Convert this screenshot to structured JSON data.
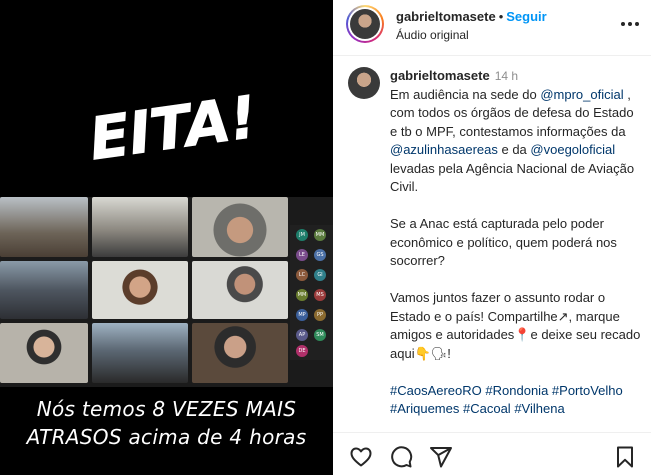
{
  "media": {
    "headline": "EITA!",
    "caption_lines": [
      "Nós temos 8 VEZES MAIS",
      "ATRASOS acima de 4 horas"
    ],
    "video_participants_initials": [
      "JM",
      "MM",
      "LE",
      "GS",
      "LC",
      "GI",
      "MM",
      "MS",
      "MP",
      "PP",
      "AP",
      "SM",
      "DE"
    ]
  },
  "header": {
    "username": "gabrieltomasete",
    "separator": "•",
    "follow_label": "Seguir",
    "audio_label": "Áudio original",
    "more_icon": "more-horizontal-icon"
  },
  "comment": {
    "username": "gabrieltomasete",
    "time": "14 h",
    "p1_a": "Em audiência na sede do ",
    "p1_mention1": "@mpro_oficial",
    "p1_b": " , com todos os órgãos de defesa do Estado e tb o MPF, contestamos informações da ",
    "p1_mention2": "@azulinhasaereas",
    "p1_c": " e da ",
    "p1_mention3": "@voegoloficial",
    "p1_d": " levadas pela Agência Nacional de Aviação Civil.",
    "p2": "Se a Anac está capturada pelo poder econômico e político, quem poderá nos socorrer?",
    "p3": "Vamos juntos fazer o assunto rodar o Estado e o país! Compartilhe↗, marque amigos e autoridades📍e deixe seu recado aqui👇🗣!",
    "hashtags": [
      "#CaosAereoRO",
      "#Rondonia",
      "#PortoVelho",
      "#Ariquemes",
      "#Cacoal",
      "#Vilhena"
    ]
  },
  "actions": {
    "like_icon": "heart-icon",
    "comment_icon": "comment-icon",
    "share_icon": "send-icon",
    "save_icon": "bookmark-icon"
  }
}
